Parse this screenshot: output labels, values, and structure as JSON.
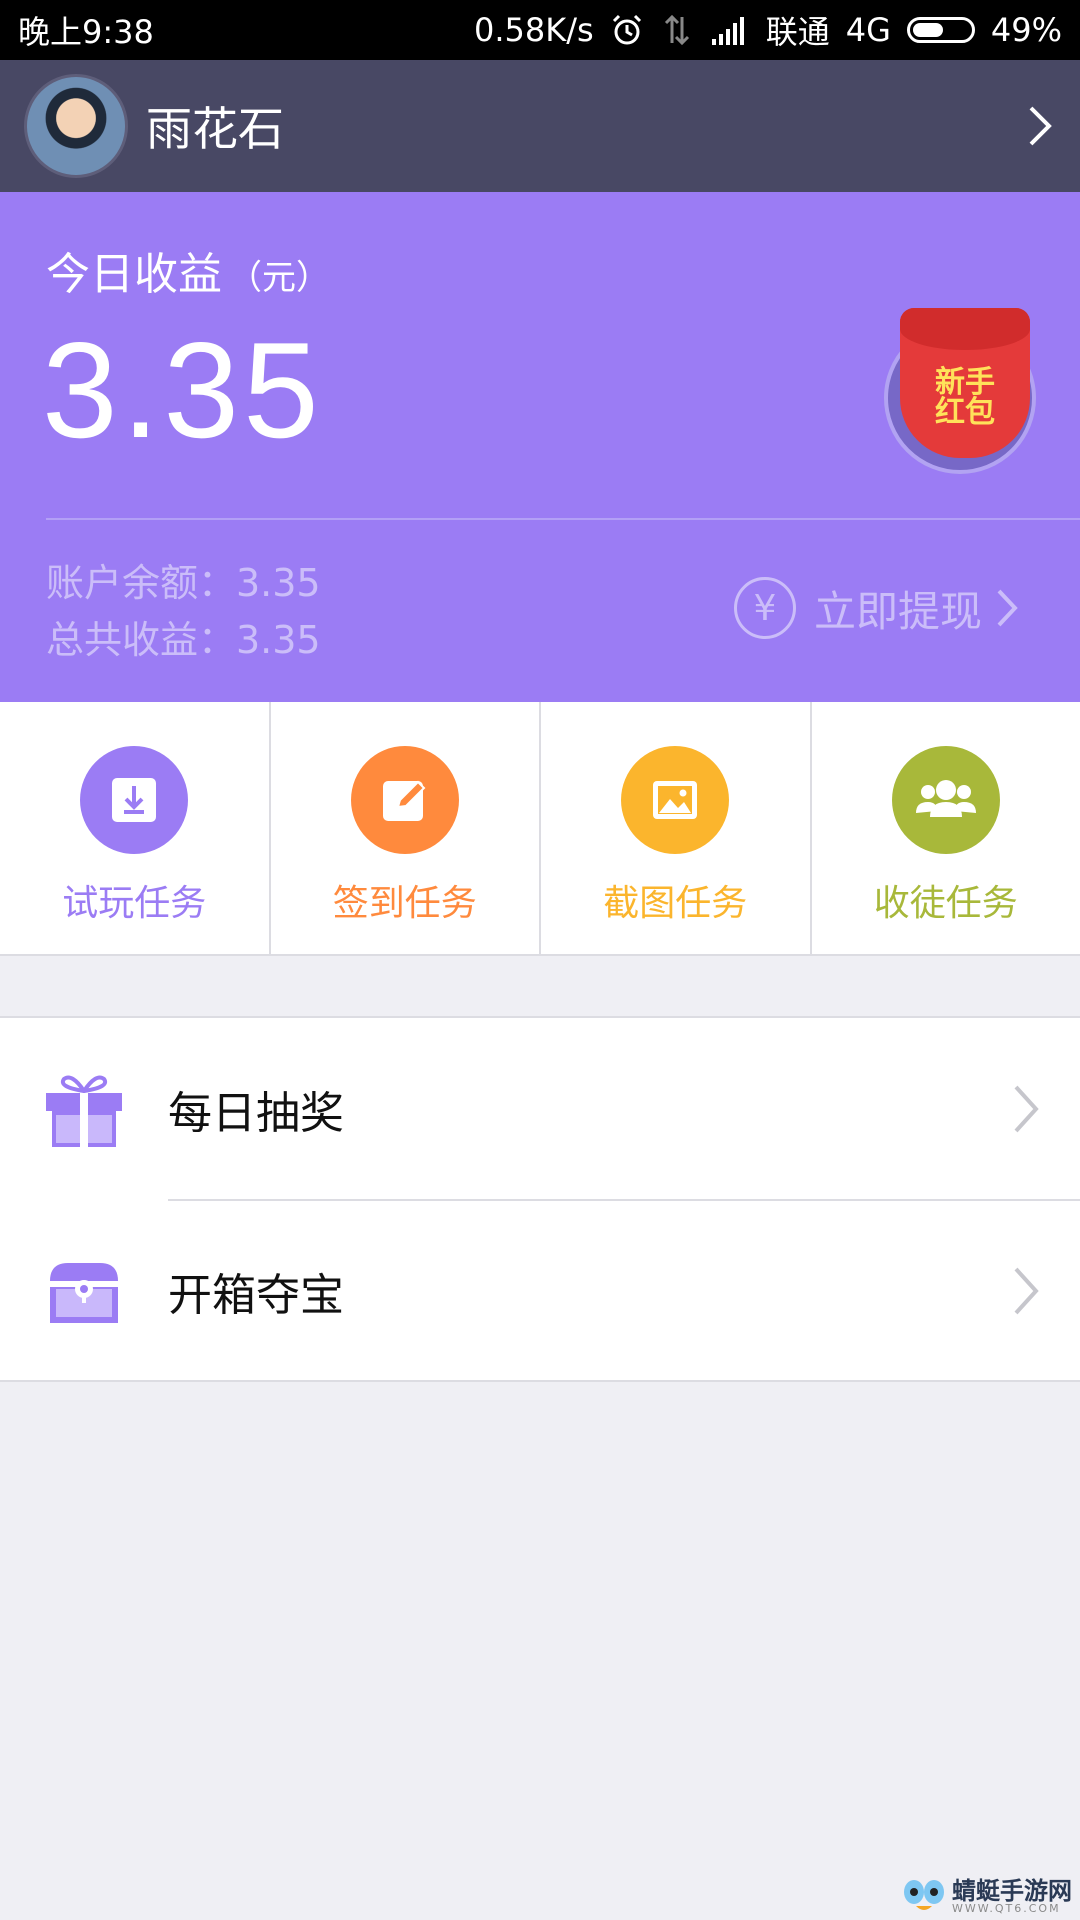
{
  "status_bar": {
    "time": "晚上9:38",
    "net_speed": "0.58K/s",
    "carrier": "联通",
    "network": "4G",
    "battery": "49%"
  },
  "profile": {
    "name": "雨花石"
  },
  "earnings": {
    "title": "今日收益",
    "unit": "（元）",
    "today_value": "3.35",
    "balance_line": "账户余额：3.35",
    "total_line": "总共收益：3.35",
    "withdraw_label": "立即提现",
    "redpack_text": "新手红包"
  },
  "tasks": [
    {
      "label": "试玩任务",
      "color": "#9b7cf4",
      "icon": "download-icon"
    },
    {
      "label": "签到任务",
      "color": "#ff8a3d",
      "icon": "edit-icon"
    },
    {
      "label": "截图任务",
      "color": "#fbb52d",
      "icon": "image-icon"
    },
    {
      "label": "收徒任务",
      "color": "#a8b83a",
      "icon": "users-icon"
    }
  ],
  "list": [
    {
      "label": "每日抽奖",
      "icon": "gift-icon"
    },
    {
      "label": "开箱夺宝",
      "icon": "treasure-chest-icon"
    }
  ],
  "watermark": {
    "text": "蜻蜓手游网",
    "sub": "WWW.QT6.COM"
  }
}
